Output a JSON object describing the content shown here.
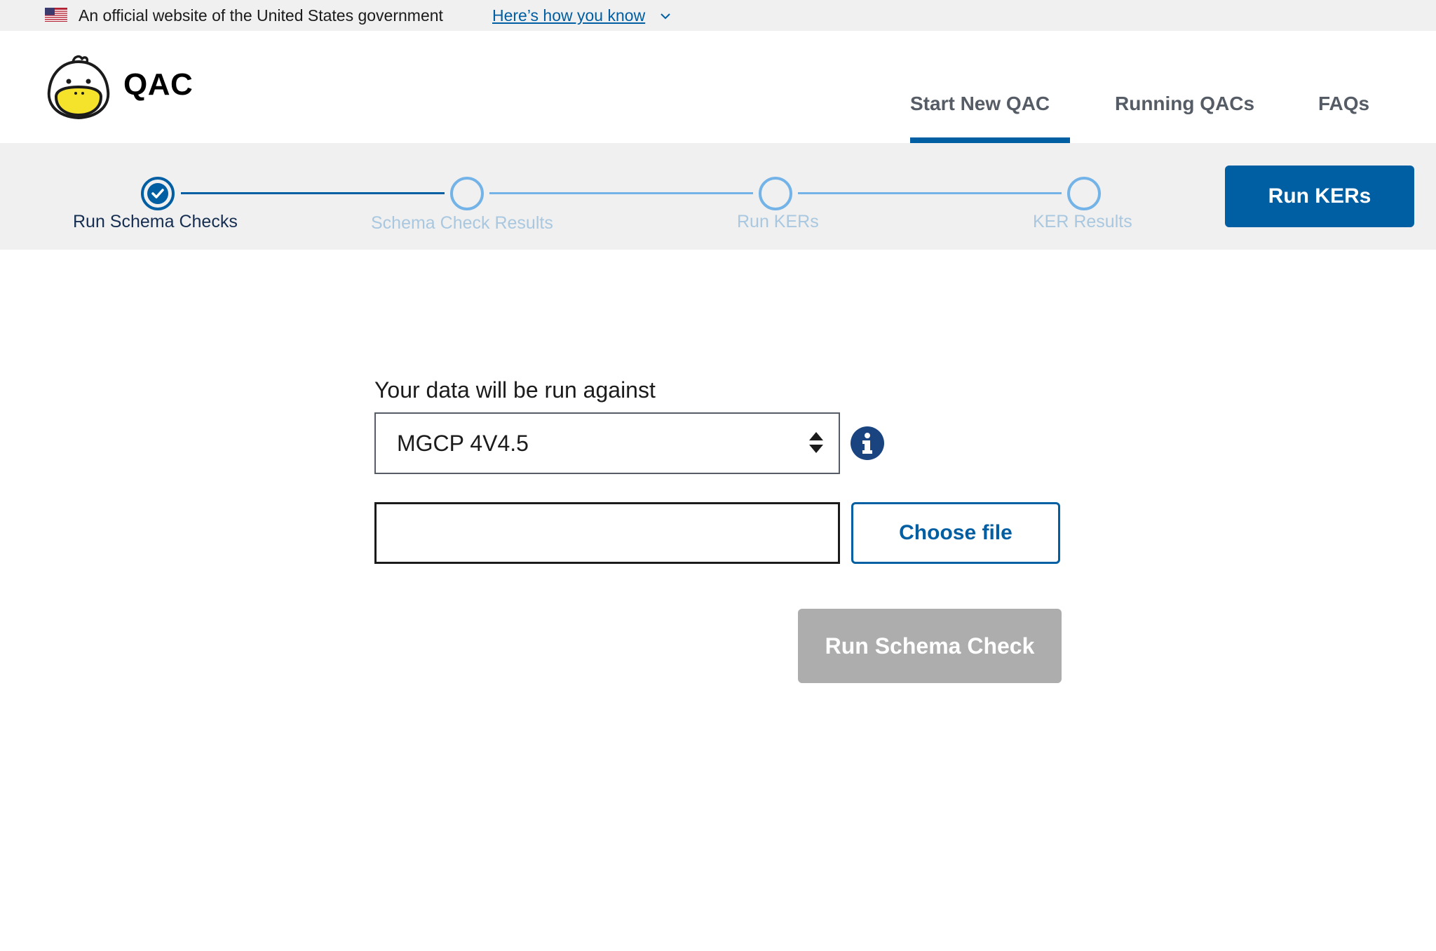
{
  "gov_banner": {
    "text": "An official website of the United States government",
    "link": "Here’s how you know"
  },
  "header": {
    "logo_text": "QAC",
    "nav": [
      {
        "label": "Start New QAC",
        "active": true
      },
      {
        "label": "Running QACs",
        "active": false
      },
      {
        "label": "FAQs",
        "active": false
      }
    ]
  },
  "stepper": {
    "steps": [
      {
        "label": "Run Schema Checks",
        "state": "complete"
      },
      {
        "label": "Schema Check Results",
        "state": "upcoming"
      },
      {
        "label": "Run KERs",
        "state": "upcoming"
      },
      {
        "label": "KER Results",
        "state": "upcoming"
      }
    ],
    "action_label": "Run KERs"
  },
  "form": {
    "label": "Your data will be run against",
    "selected_schema": "MGCP 4V4.5",
    "file_value": "",
    "choose_file_label": "Choose file",
    "run_button_label": "Run Schema Check",
    "run_button_disabled": true
  },
  "colors": {
    "primary": "#005ea2",
    "primary_light": "#73b3e7",
    "banner_bg": "#f0f0f0",
    "disabled": "#adadad",
    "duck_beak": "#f5e22b"
  },
  "icons": [
    "us-flag-icon",
    "chevron-down-icon",
    "duck-logo-icon",
    "checkmark-icon",
    "select-arrows-icon",
    "info-icon"
  ]
}
